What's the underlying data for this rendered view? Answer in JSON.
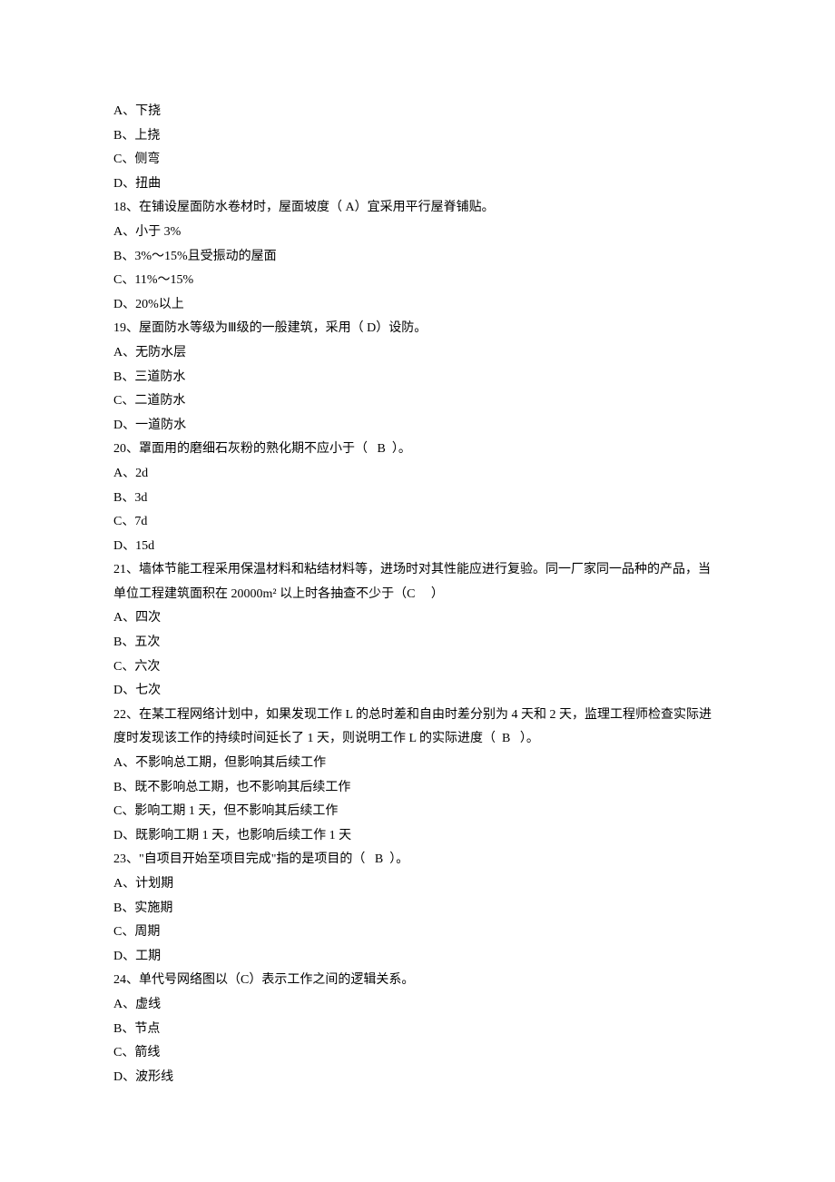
{
  "lines": [
    "A、下挠",
    "B、上挠",
    "C、侧弯",
    "D、扭曲",
    "18、在铺设屋面防水卷材时，屋面坡度（ A）宜采用平行屋脊铺贴。",
    "A、小于 3%",
    "B、3%～15%且受振动的屋面",
    "C、11%～15%",
    "D、20%以上",
    "19、屋面防水等级为Ⅲ级的一般建筑，采用（ D）设防。",
    "A、无防水层",
    "B、三道防水",
    "C、二道防水",
    "D、一道防水",
    "20、罩面用的磨细石灰粉的熟化期不应小于（   B  ）。",
    "A、2d",
    "B、3d",
    "C、7d",
    "D、15d",
    "21、墙体节能工程采用保温材料和粘结材料等，进场时对其性能应进行复验。同一厂家同一品种的产品，当单位工程建筑面积在 20000m² 以上时各抽查不少于（C     ）",
    "A、四次",
    "B、五次",
    "C、六次",
    "D、七次",
    "22、在某工程网络计划中，如果发现工作 L 的总时差和自由时差分别为 4 天和 2 天，监理工程师检查实际进度时发现该工作的持续时间延长了 1 天，则说明工作 L 的实际进度（  B   ）。",
    "A、不影响总工期，但影响其后续工作",
    "B、既不影响总工期，也不影响其后续工作",
    "C、影响工期 1 天，但不影响其后续工作",
    "D、既影响工期 1 天，也影响后续工作 1 天",
    "23、\"自项目开始至项目完成\"指的是项目的（   B  ）。",
    "A、计划期",
    "B、实施期",
    "C、周期",
    "D、工期",
    "24、单代号网络图以（C）表示工作之间的逻辑关系。",
    "A、虚线",
    "B、节点",
    "C、箭线",
    "D、波形线"
  ]
}
